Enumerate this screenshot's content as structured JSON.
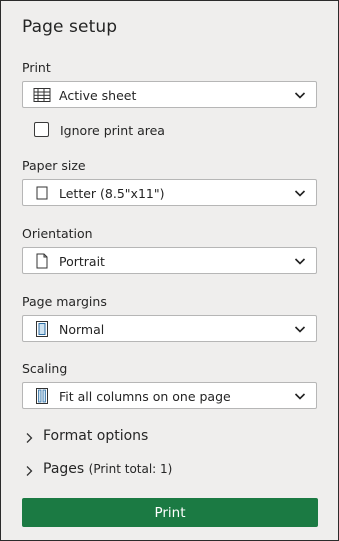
{
  "panel": {
    "title": "Page setup"
  },
  "print": {
    "label": "Print",
    "selected": "Active sheet",
    "icon": "sheet-grid-icon"
  },
  "ignore_print_area": {
    "label": "Ignore print area",
    "checked": false
  },
  "paper_size": {
    "label": "Paper size",
    "selected": "Letter (8.5\"x11\")",
    "icon": "paper-icon"
  },
  "orientation": {
    "label": "Orientation",
    "selected": "Portrait",
    "icon": "portrait-page-icon"
  },
  "page_margins": {
    "label": "Page margins",
    "selected": "Normal",
    "icon": "margins-icon"
  },
  "scaling": {
    "label": "Scaling",
    "selected": "Fit all columns on one page",
    "icon": "fit-columns-icon"
  },
  "format_options": {
    "label": "Format options"
  },
  "pages": {
    "label": "Pages",
    "detail": "(Print total: 1)"
  },
  "print_button": {
    "label": "Print",
    "color": "#1b7a43"
  }
}
